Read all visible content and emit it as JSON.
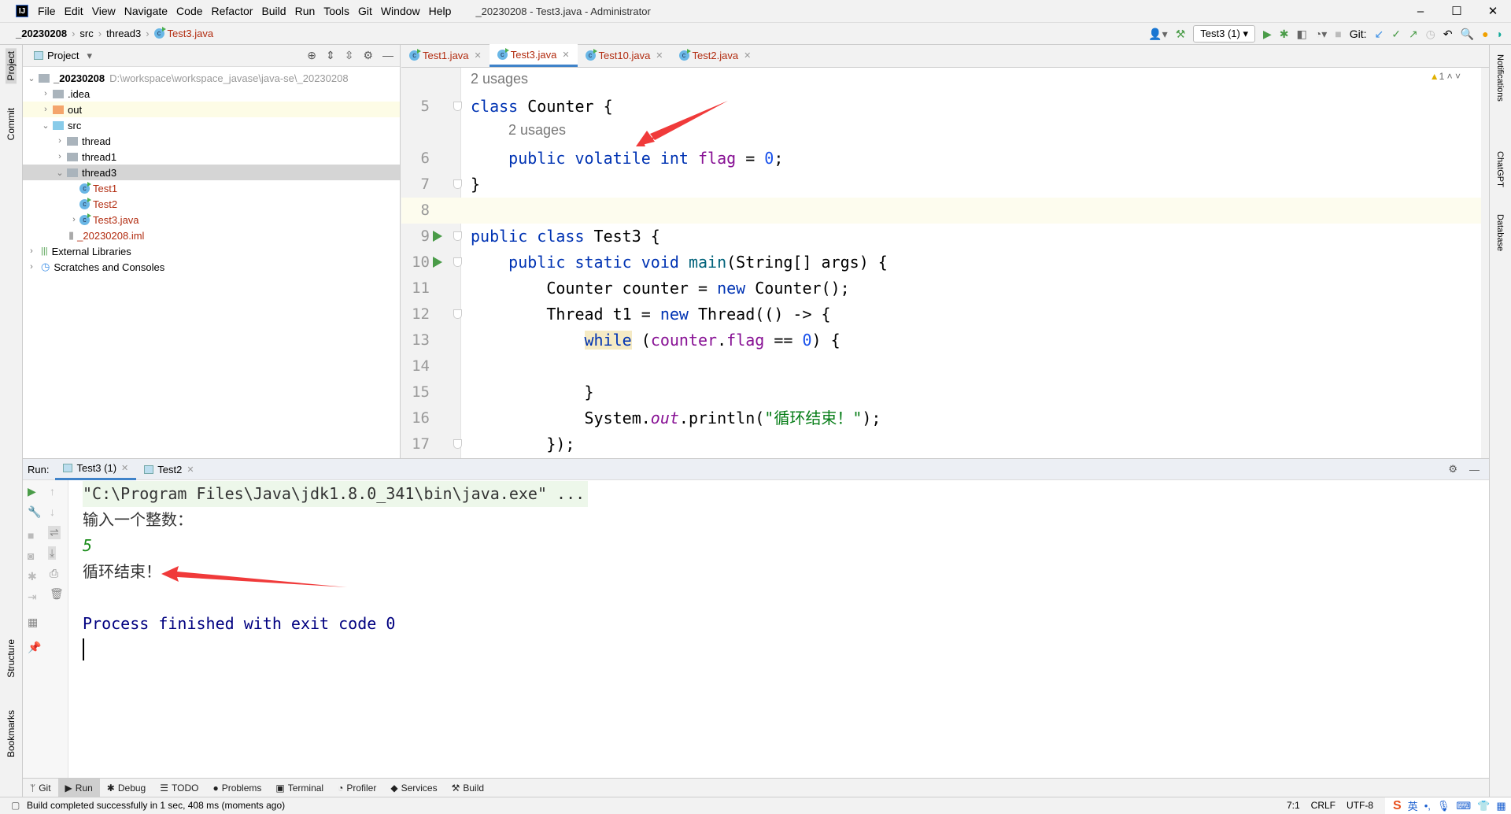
{
  "window": {
    "title": "_20230208 - Test3.java - Administrator",
    "minimize": "–",
    "maximize": "☐",
    "close": "✕"
  },
  "menu": [
    "File",
    "Edit",
    "View",
    "Navigate",
    "Code",
    "Refactor",
    "Build",
    "Run",
    "Tools",
    "Git",
    "Window",
    "Help"
  ],
  "breadcrumb": [
    "_20230208",
    "src",
    "thread3",
    "Test3.java"
  ],
  "toolbar": {
    "run_config": "Test3 (1)",
    "git_label": "Git:"
  },
  "left_stripe": [
    "Project",
    "Commit",
    "Structure",
    "Bookmarks"
  ],
  "right_stripe": [
    "Notifications",
    "ChatGPT",
    "Database"
  ],
  "project": {
    "title": "Project",
    "tree": [
      {
        "label": "_20230208",
        "extra": "D:\\workspace\\workspace_javase\\java-se\\_20230208",
        "indent": 0,
        "arrow": "⌄",
        "icon": "module"
      },
      {
        "label": ".idea",
        "indent": 1,
        "arrow": "›",
        "icon": "folder"
      },
      {
        "label": "out",
        "indent": 1,
        "arrow": "›",
        "icon": "folder-orange"
      },
      {
        "label": "src",
        "indent": 1,
        "arrow": "⌄",
        "icon": "folder-src"
      },
      {
        "label": "thread",
        "indent": 2,
        "arrow": "›",
        "icon": "package"
      },
      {
        "label": "thread1",
        "indent": 2,
        "arrow": "›",
        "icon": "package"
      },
      {
        "label": "thread3",
        "indent": 2,
        "arrow": "⌄",
        "icon": "package"
      },
      {
        "label": "Test1",
        "indent": 3,
        "arrow": "",
        "icon": "class"
      },
      {
        "label": "Test2",
        "indent": 3,
        "arrow": "",
        "icon": "class"
      },
      {
        "label": "Test3.java",
        "indent": 3,
        "arrow": "›",
        "icon": "class"
      },
      {
        "label": "_20230208.iml",
        "indent": 2,
        "arrow": "",
        "icon": "file"
      },
      {
        "label": "External Libraries",
        "indent": 0,
        "arrow": "›",
        "icon": "library"
      },
      {
        "label": "Scratches and Consoles",
        "indent": 0,
        "arrow": "›",
        "icon": "scratch"
      }
    ]
  },
  "tabs": [
    {
      "label": "Test1.java"
    },
    {
      "label": "Test3.java",
      "active": true
    },
    {
      "label": "Test10.java"
    },
    {
      "label": "Test2.java"
    }
  ],
  "editor": {
    "warnings": "1",
    "usage_hint": "2 usages",
    "lines": [
      {
        "n": "5",
        "fold": true,
        "tokens": [
          [
            "kw",
            "class "
          ],
          [
            "",
            "Counter {"
          ]
        ]
      },
      {
        "n": "6",
        "usage": "2 usages",
        "tokens": [
          [
            "",
            "    "
          ],
          [
            "kw",
            "public volatile int "
          ],
          [
            "fld",
            "flag"
          ],
          [
            "",
            " = "
          ],
          [
            "num",
            "0"
          ],
          [
            "",
            ";"
          ]
        ]
      },
      {
        "n": "7",
        "fold": true,
        "tokens": [
          [
            "",
            "}"
          ]
        ]
      },
      {
        "n": "8",
        "current": true,
        "tokens": []
      },
      {
        "n": "9",
        "run": true,
        "fold": true,
        "tokens": [
          [
            "kw",
            "public class "
          ],
          [
            "",
            "Test3 {"
          ]
        ]
      },
      {
        "n": "10",
        "run": true,
        "fold": true,
        "tokens": [
          [
            "",
            "    "
          ],
          [
            "kw",
            "public static void "
          ],
          [
            "mth",
            "main"
          ],
          [
            "",
            "(String[] args) {"
          ]
        ]
      },
      {
        "n": "11",
        "tokens": [
          [
            "",
            "        Counter counter = "
          ],
          [
            "kw",
            "new "
          ],
          [
            "",
            "Counter();"
          ]
        ]
      },
      {
        "n": "12",
        "fold": true,
        "tokens": [
          [
            "",
            "        Thread t1 = "
          ],
          [
            "kw",
            "new "
          ],
          [
            "",
            "Thread(() -> {"
          ]
        ]
      },
      {
        "n": "13",
        "tokens": [
          [
            "",
            "            "
          ],
          [
            "kw hlw",
            "while"
          ],
          [
            "",
            " ("
          ],
          [
            "fld",
            "counter"
          ],
          [
            "",
            "."
          ],
          [
            "fld",
            "flag"
          ],
          [
            "",
            " == "
          ],
          [
            "num",
            "0"
          ],
          [
            "",
            ") {"
          ]
        ]
      },
      {
        "n": "14",
        "tokens": []
      },
      {
        "n": "15",
        "tokens": [
          [
            "",
            "            }"
          ]
        ]
      },
      {
        "n": "16",
        "tokens": [
          [
            "",
            "            System."
          ],
          [
            "itl",
            "out"
          ],
          [
            "",
            ".println("
          ],
          [
            "str",
            "\"循环结束！\""
          ],
          [
            "",
            ");"
          ]
        ]
      },
      {
        "n": "17",
        "fold": true,
        "tokens": [
          [
            "",
            "        });"
          ]
        ]
      }
    ]
  },
  "run": {
    "label": "Run:",
    "tabs": [
      {
        "label": "Test3 (1)",
        "active": true
      },
      {
        "label": "Test2"
      }
    ],
    "console": {
      "command": "\"C:\\Program Files\\Java\\jdk1.8.0_341\\bin\\java.exe\" ...",
      "prompt": "输入一个整数：",
      "input": "5",
      "output": "循环结束！",
      "exit": "Process finished with exit code 0"
    }
  },
  "bottom_tabs": [
    {
      "label": "Git",
      "icon": "ᛘ"
    },
    {
      "label": "Run",
      "icon": "▶",
      "active": true
    },
    {
      "label": "Debug",
      "icon": "✱"
    },
    {
      "label": "TODO",
      "icon": "☰"
    },
    {
      "label": "Problems",
      "icon": "●"
    },
    {
      "label": "Terminal",
      "icon": "▣"
    },
    {
      "label": "Profiler",
      "icon": "◔"
    },
    {
      "label": "Services",
      "icon": "◆"
    },
    {
      "label": "Build",
      "icon": "⚒"
    }
  ],
  "status": {
    "message": "Build completed successfully in 1 sec, 408 ms (moments ago)",
    "position": "7:1",
    "line_sep": "CRLF",
    "encoding": "UTF-8",
    "ime": "英"
  },
  "colors": {
    "keyword": "#0033b3",
    "field": "#871094",
    "number": "#1750eb",
    "string": "#067d17",
    "accent": "#4083c9",
    "annotation_arrow": "#f03a3a"
  }
}
